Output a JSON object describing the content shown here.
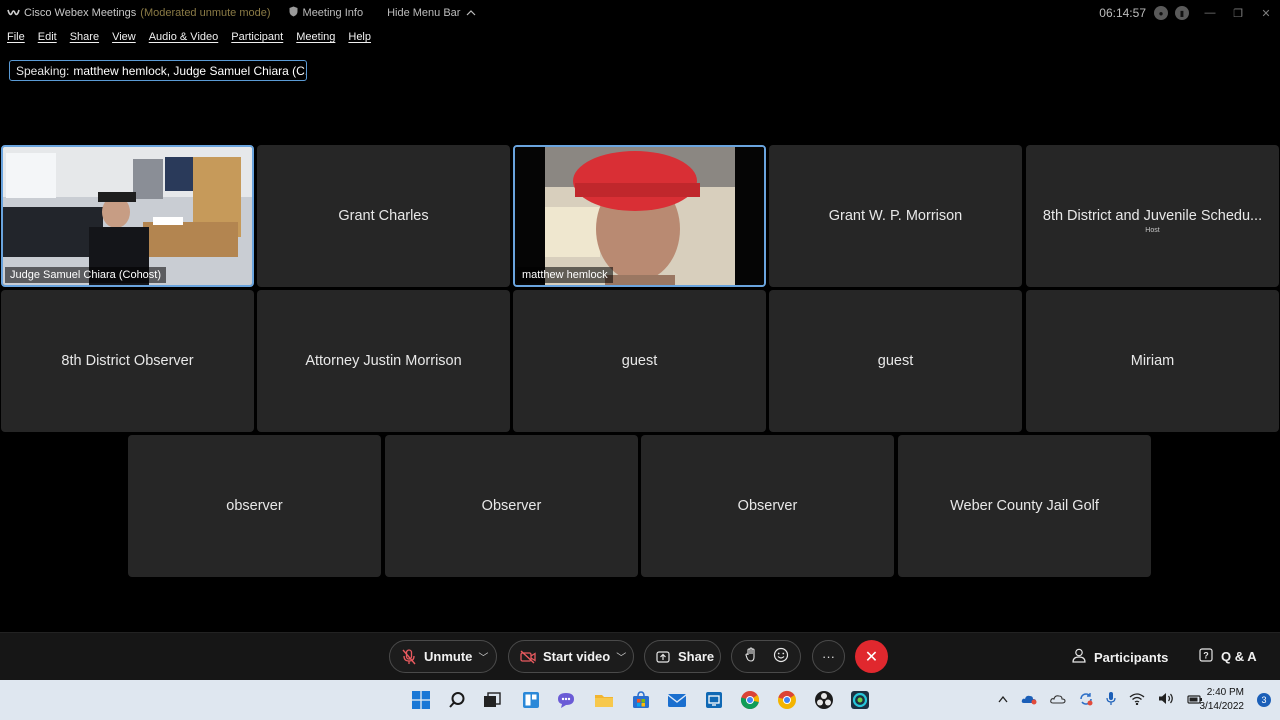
{
  "titlebar": {
    "app_title": "Cisco Webex Meetings",
    "mode": "(Moderated unmute mode)",
    "meeting_info": "Meeting Info",
    "hide_menu": "Hide Menu Bar",
    "time": "06:14:57"
  },
  "menu": [
    "File",
    "Edit",
    "Share",
    "View",
    "Audio & Video",
    "Participant",
    "Meeting",
    "Help"
  ],
  "speaking": {
    "label": "Speaking:",
    "names": "matthew hemlock, Judge Samuel Chiara (C..."
  },
  "tiles": [
    {
      "name": "Judge Samuel Chiara (Cohost)",
      "video": true
    },
    {
      "name": "Grant Charles",
      "video": false
    },
    {
      "name": "matthew hemlock",
      "video": true
    },
    {
      "name": "Grant W. P. Morrison",
      "video": false
    },
    {
      "name": "8th District and Juvenile Schedu...",
      "sub": "Host",
      "video": false
    },
    {
      "name": "8th District Observer",
      "video": false
    },
    {
      "name": "Attorney Justin Morrison",
      "video": false
    },
    {
      "name": "guest",
      "video": false
    },
    {
      "name": "guest",
      "video": false
    },
    {
      "name": "Miriam",
      "video": false
    },
    {
      "name": "observer",
      "video": false
    },
    {
      "name": "Observer",
      "video": false
    },
    {
      "name": "Observer",
      "video": false
    },
    {
      "name": "Weber County Jail Golf",
      "video": false
    }
  ],
  "toolbar": {
    "unmute": "Unmute",
    "start_video": "Start video",
    "share": "Share",
    "participants": "Participants",
    "qa": "Q & A"
  },
  "taskbar": {
    "time": "2:40 PM",
    "date": "3/14/2022",
    "notifications": "3"
  },
  "colors": {
    "active_border": "#6aa4de",
    "end_call": "#e0282e",
    "tile_bg": "#262626"
  }
}
